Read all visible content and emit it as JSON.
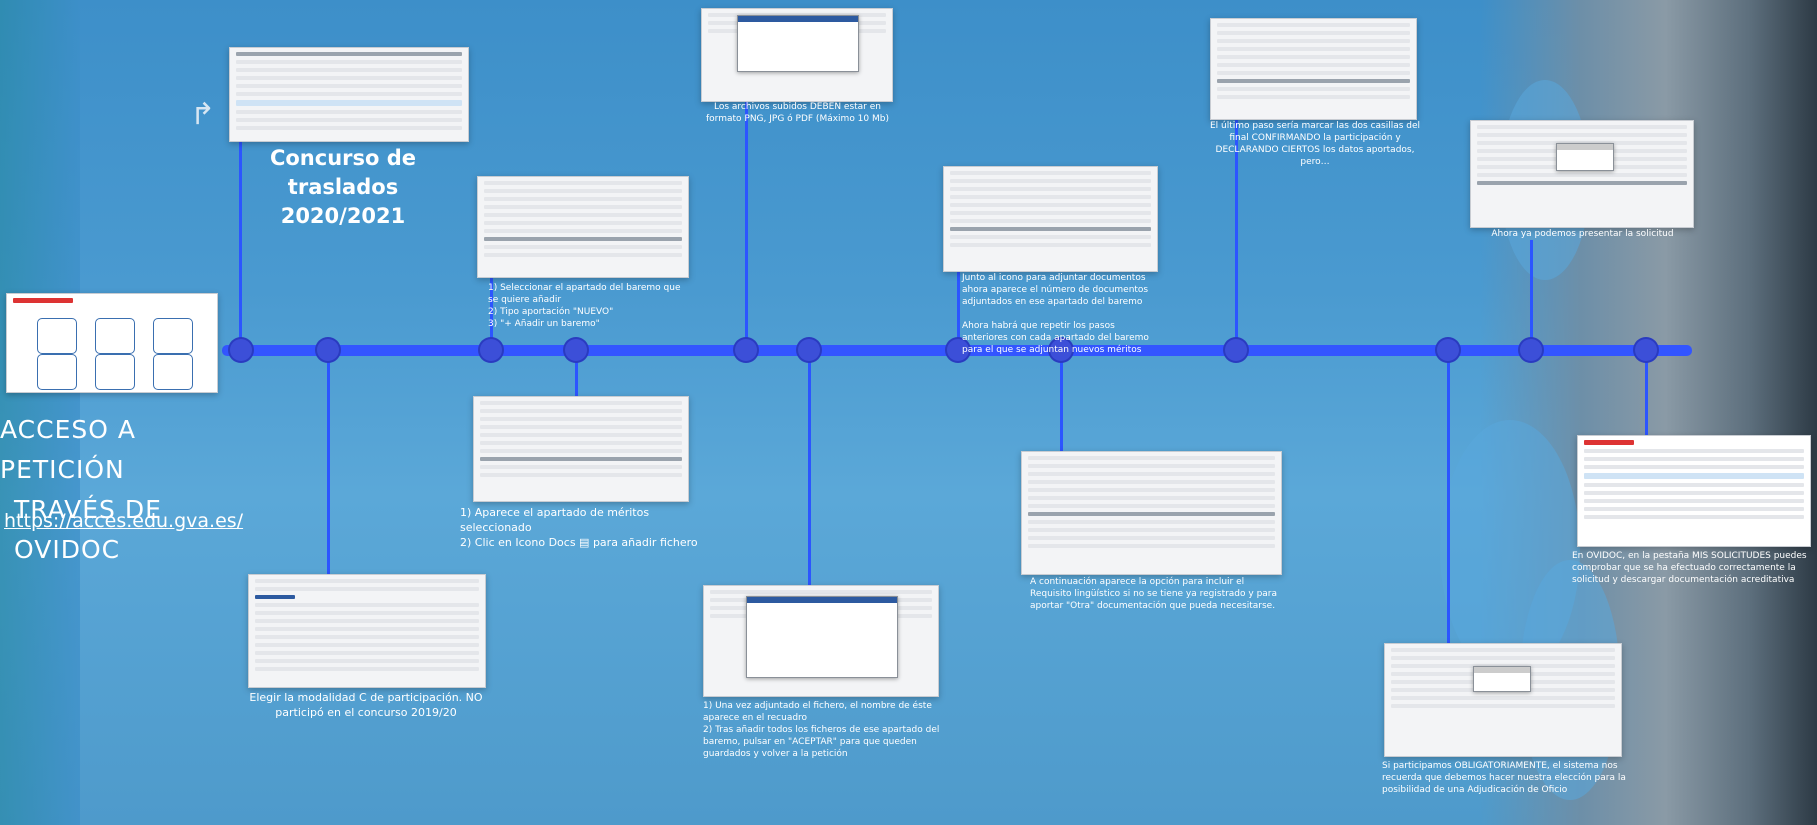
{
  "title": "Concurso de traslados 2020/2021",
  "access": {
    "line1": "ACCESO A PETICIÓN",
    "line2": "TRAVÉS DE OVIDOC",
    "url": "https://acces.edu.gva.es/"
  },
  "captions": {
    "formats": "Los archivos subidos DEBEN estar en formato PNG, JPG ó PDF (Máximo 10 Mb)",
    "last_step": "El último paso sería marcar las dos casillas del final CONFIRMANDO la participación y DECLARANDO CIERTOS los datos aportados, pero…",
    "present": "Ahora ya podemos presentar la solicitud",
    "select_section": "1) Seleccionar el apartado del baremo que se quiere añadir\n2) Tipo aportación \"NUEVO\"\n3) \"+ Añadir un baremo\"",
    "next_to_icon": "Junto al icono para adjuntar documentos ahora aparece el número de documentos adjuntados en ese apartado del baremo\n\nAhora habrá que repetir los pasos anteriores con cada apartado del baremo para el que se adjuntan nuevos méritos",
    "merits_appear": "1) Aparece el apartado de méritos seleccionado\n2) Clic en Icono Docs ▤ para añadir fichero",
    "choose_mode": "Elegir la modalidad C de participación. NO participó en el concurso 2019/20",
    "once_attached": "1) Una vez adjuntado el fichero, el nombre de éste aparece en el recuadro\n2) Tras añadir todos los ficheros de ese apartado del baremo, pulsar en \"ACEPTAR\" para que queden guardados y volver a la petición",
    "linguistic": "A continuación aparece la opción para incluir el Requisito lingüístico si no se tiene ya registrado y para aportar \"Otra\" documentación que pueda necesitarse.",
    "mandatory": "Si participamos OBLIGATORIAMENTE, el sistema nos recuerda que debemos hacer nuestra elección para la posibilidad de una Adjudicación de Oficio",
    "my_requests": "En OVIDOC, en la pestaña MIS SOLICITUDES puedes comprobar que se ha efectuado correctamente la solicitud y descargar documentación acreditativa"
  },
  "icons": [
    "redo-arrow-icon",
    "docs-icon"
  ],
  "colors": {
    "timeline": "#3355ff",
    "node": "#3c4fd8",
    "text": "#ffffff"
  }
}
